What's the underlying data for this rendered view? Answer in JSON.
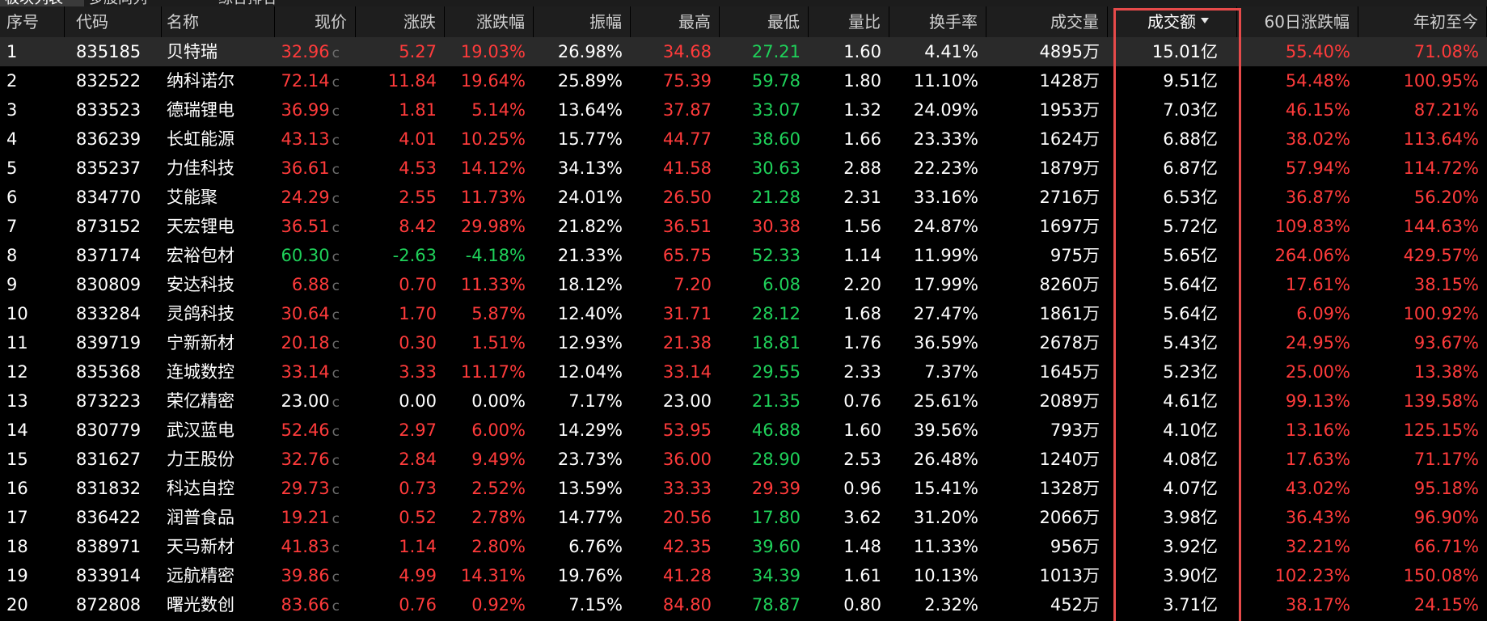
{
  "tabs": [
    {
      "label": "板块列表"
    },
    {
      "label": "多股同列"
    },
    {
      "label": "综合排名"
    }
  ],
  "columns": [
    {
      "key": "seq",
      "label": "序号"
    },
    {
      "key": "code",
      "label": "代码"
    },
    {
      "key": "name",
      "label": "名称"
    },
    {
      "key": "price",
      "label": "现价"
    },
    {
      "key": "change",
      "label": "涨跌"
    },
    {
      "key": "pct",
      "label": "涨跌幅"
    },
    {
      "key": "amp",
      "label": "振幅"
    },
    {
      "key": "high",
      "label": "最高"
    },
    {
      "key": "low",
      "label": "最低"
    },
    {
      "key": "vr",
      "label": "量比"
    },
    {
      "key": "turn",
      "label": "换手率"
    },
    {
      "key": "vol",
      "label": "成交量"
    },
    {
      "key": "amount",
      "label": "成交额"
    },
    {
      "key": "pct60",
      "label": "60日涨跌幅"
    },
    {
      "key": "ytd",
      "label": "年初至今"
    }
  ],
  "sort_column": "amount",
  "price_suffix": "c",
  "colors": {
    "up": "#ff3b3b",
    "down": "#1fd15a",
    "flat": "#ffffff",
    "highlight_border": "#e64a4a"
  },
  "rows": [
    {
      "seq": "1",
      "code": "835185",
      "name": "贝特瑞",
      "price": "32.96",
      "change": "5.27",
      "pct": "19.03%",
      "amp": "26.98%",
      "high": "34.68",
      "low": "27.21",
      "vr": "1.60",
      "turn": "4.41%",
      "vol": "4895万",
      "amount": "15.01亿",
      "pct60": "55.40%",
      "ytd": "71.08%",
      "price_c": "red",
      "high_c": "red",
      "low_c": "green",
      "pct60_c": "red",
      "ytd_c": "red"
    },
    {
      "seq": "2",
      "code": "832522",
      "name": "纳科诺尔",
      "price": "72.14",
      "change": "11.84",
      "pct": "19.64%",
      "amp": "25.89%",
      "high": "75.39",
      "low": "59.78",
      "vr": "1.80",
      "turn": "11.10%",
      "vol": "1428万",
      "amount": "9.51亿",
      "pct60": "54.48%",
      "ytd": "100.95%",
      "price_c": "red",
      "high_c": "red",
      "low_c": "green",
      "pct60_c": "red",
      "ytd_c": "red"
    },
    {
      "seq": "3",
      "code": "833523",
      "name": "德瑞锂电",
      "price": "36.99",
      "change": "1.81",
      "pct": "5.14%",
      "amp": "13.64%",
      "high": "37.87",
      "low": "33.07",
      "vr": "1.32",
      "turn": "24.09%",
      "vol": "1953万",
      "amount": "7.03亿",
      "pct60": "46.15%",
      "ytd": "87.21%",
      "price_c": "red",
      "high_c": "red",
      "low_c": "green",
      "pct60_c": "red",
      "ytd_c": "red"
    },
    {
      "seq": "4",
      "code": "836239",
      "name": "长虹能源",
      "price": "43.13",
      "change": "4.01",
      "pct": "10.25%",
      "amp": "15.77%",
      "high": "44.77",
      "low": "38.60",
      "vr": "1.66",
      "turn": "23.33%",
      "vol": "1624万",
      "amount": "6.88亿",
      "pct60": "38.02%",
      "ytd": "113.64%",
      "price_c": "red",
      "high_c": "red",
      "low_c": "green",
      "pct60_c": "red",
      "ytd_c": "red"
    },
    {
      "seq": "5",
      "code": "835237",
      "name": "力佳科技",
      "price": "36.61",
      "change": "4.53",
      "pct": "14.12%",
      "amp": "34.13%",
      "high": "41.58",
      "low": "30.63",
      "vr": "2.88",
      "turn": "22.23%",
      "vol": "1879万",
      "amount": "6.87亿",
      "pct60": "57.94%",
      "ytd": "114.72%",
      "price_c": "red",
      "high_c": "red",
      "low_c": "green",
      "pct60_c": "red",
      "ytd_c": "red"
    },
    {
      "seq": "6",
      "code": "834770",
      "name": "艾能聚",
      "price": "24.29",
      "change": "2.55",
      "pct": "11.73%",
      "amp": "24.01%",
      "high": "26.50",
      "low": "21.28",
      "vr": "2.31",
      "turn": "33.16%",
      "vol": "2716万",
      "amount": "6.53亿",
      "pct60": "36.87%",
      "ytd": "56.20%",
      "price_c": "red",
      "high_c": "red",
      "low_c": "green",
      "pct60_c": "red",
      "ytd_c": "red"
    },
    {
      "seq": "7",
      "code": "873152",
      "name": "天宏锂电",
      "price": "36.51",
      "change": "8.42",
      "pct": "29.98%",
      "amp": "21.82%",
      "high": "36.51",
      "low": "30.38",
      "vr": "1.56",
      "turn": "24.87%",
      "vol": "1697万",
      "amount": "5.72亿",
      "pct60": "109.83%",
      "ytd": "144.63%",
      "price_c": "red",
      "high_c": "red",
      "low_c": "red",
      "pct60_c": "red",
      "ytd_c": "red"
    },
    {
      "seq": "8",
      "code": "837174",
      "name": "宏裕包材",
      "price": "60.30",
      "change": "-2.63",
      "pct": "-4.18%",
      "amp": "21.33%",
      "high": "65.75",
      "low": "52.33",
      "vr": "1.14",
      "turn": "11.99%",
      "vol": "975万",
      "amount": "5.65亿",
      "pct60": "264.06%",
      "ytd": "429.57%",
      "price_c": "green",
      "high_c": "red",
      "low_c": "green",
      "pct60_c": "red",
      "ytd_c": "red"
    },
    {
      "seq": "9",
      "code": "830809",
      "name": "安达科技",
      "price": "6.88",
      "change": "0.70",
      "pct": "11.33%",
      "amp": "18.12%",
      "high": "7.20",
      "low": "6.08",
      "vr": "2.20",
      "turn": "17.99%",
      "vol": "8260万",
      "amount": "5.64亿",
      "pct60": "17.61%",
      "ytd": "38.15%",
      "price_c": "red",
      "high_c": "red",
      "low_c": "green",
      "pct60_c": "red",
      "ytd_c": "red"
    },
    {
      "seq": "10",
      "code": "833284",
      "name": "灵鸽科技",
      "price": "30.64",
      "change": "1.70",
      "pct": "5.87%",
      "amp": "12.40%",
      "high": "31.71",
      "low": "28.12",
      "vr": "1.68",
      "turn": "27.47%",
      "vol": "1861万",
      "amount": "5.64亿",
      "pct60": "6.09%",
      "ytd": "100.92%",
      "price_c": "red",
      "high_c": "red",
      "low_c": "green",
      "pct60_c": "red",
      "ytd_c": "red"
    },
    {
      "seq": "11",
      "code": "839719",
      "name": "宁新新材",
      "price": "20.18",
      "change": "0.30",
      "pct": "1.51%",
      "amp": "12.93%",
      "high": "21.38",
      "low": "18.81",
      "vr": "1.76",
      "turn": "36.59%",
      "vol": "2678万",
      "amount": "5.43亿",
      "pct60": "24.95%",
      "ytd": "93.67%",
      "price_c": "red",
      "high_c": "red",
      "low_c": "green",
      "pct60_c": "red",
      "ytd_c": "red"
    },
    {
      "seq": "12",
      "code": "835368",
      "name": "连城数控",
      "price": "33.14",
      "change": "3.33",
      "pct": "11.17%",
      "amp": "12.04%",
      "high": "33.14",
      "low": "29.55",
      "vr": "2.33",
      "turn": "7.37%",
      "vol": "1645万",
      "amount": "5.23亿",
      "pct60": "25.00%",
      "ytd": "13.38%",
      "price_c": "red",
      "high_c": "red",
      "low_c": "green",
      "pct60_c": "red",
      "ytd_c": "red"
    },
    {
      "seq": "13",
      "code": "873223",
      "name": "荣亿精密",
      "price": "23.00",
      "change": "0.00",
      "pct": "0.00%",
      "amp": "7.17%",
      "high": "23.00",
      "low": "21.35",
      "vr": "0.76",
      "turn": "25.61%",
      "vol": "2089万",
      "amount": "4.61亿",
      "pct60": "99.13%",
      "ytd": "139.58%",
      "price_c": "white",
      "high_c": "white",
      "low_c": "green",
      "pct60_c": "red",
      "ytd_c": "red"
    },
    {
      "seq": "14",
      "code": "830779",
      "name": "武汉蓝电",
      "price": "52.46",
      "change": "2.97",
      "pct": "6.00%",
      "amp": "14.29%",
      "high": "53.95",
      "low": "46.88",
      "vr": "1.60",
      "turn": "39.56%",
      "vol": "793万",
      "amount": "4.10亿",
      "pct60": "13.16%",
      "ytd": "125.15%",
      "price_c": "red",
      "high_c": "red",
      "low_c": "green",
      "pct60_c": "red",
      "ytd_c": "red"
    },
    {
      "seq": "15",
      "code": "831627",
      "name": "力王股份",
      "price": "32.76",
      "change": "2.84",
      "pct": "9.49%",
      "amp": "23.73%",
      "high": "36.00",
      "low": "28.90",
      "vr": "2.53",
      "turn": "26.48%",
      "vol": "1240万",
      "amount": "4.08亿",
      "pct60": "17.63%",
      "ytd": "71.17%",
      "price_c": "red",
      "high_c": "red",
      "low_c": "green",
      "pct60_c": "red",
      "ytd_c": "red"
    },
    {
      "seq": "16",
      "code": "831832",
      "name": "科达自控",
      "price": "29.73",
      "change": "0.73",
      "pct": "2.52%",
      "amp": "13.59%",
      "high": "33.33",
      "low": "29.39",
      "vr": "0.96",
      "turn": "15.41%",
      "vol": "1328万",
      "amount": "4.07亿",
      "pct60": "43.02%",
      "ytd": "95.18%",
      "price_c": "red",
      "high_c": "red",
      "low_c": "red",
      "pct60_c": "red",
      "ytd_c": "red"
    },
    {
      "seq": "17",
      "code": "836422",
      "name": "润普食品",
      "price": "19.21",
      "change": "0.52",
      "pct": "2.78%",
      "amp": "14.77%",
      "high": "20.56",
      "low": "17.80",
      "vr": "3.62",
      "turn": "31.20%",
      "vol": "2066万",
      "amount": "3.98亿",
      "pct60": "36.43%",
      "ytd": "96.90%",
      "price_c": "red",
      "high_c": "red",
      "low_c": "green",
      "pct60_c": "red",
      "ytd_c": "red"
    },
    {
      "seq": "18",
      "code": "838971",
      "name": "天马新材",
      "price": "41.83",
      "change": "1.14",
      "pct": "2.80%",
      "amp": "6.76%",
      "high": "42.35",
      "low": "39.60",
      "vr": "1.48",
      "turn": "11.33%",
      "vol": "956万",
      "amount": "3.92亿",
      "pct60": "32.21%",
      "ytd": "66.71%",
      "price_c": "red",
      "high_c": "red",
      "low_c": "green",
      "pct60_c": "red",
      "ytd_c": "red"
    },
    {
      "seq": "19",
      "code": "833914",
      "name": "远航精密",
      "price": "39.86",
      "change": "4.99",
      "pct": "14.31%",
      "amp": "19.76%",
      "high": "41.28",
      "low": "34.39",
      "vr": "1.61",
      "turn": "10.13%",
      "vol": "1013万",
      "amount": "3.90亿",
      "pct60": "102.23%",
      "ytd": "150.08%",
      "price_c": "red",
      "high_c": "red",
      "low_c": "green",
      "pct60_c": "red",
      "ytd_c": "red"
    },
    {
      "seq": "20",
      "code": "872808",
      "name": "曙光数创",
      "price": "83.66",
      "change": "0.76",
      "pct": "0.92%",
      "amp": "7.15%",
      "high": "84.80",
      "low": "78.87",
      "vr": "0.80",
      "turn": "2.32%",
      "vol": "452万",
      "amount": "3.71亿",
      "pct60": "38.17%",
      "ytd": "24.15%",
      "price_c": "red",
      "high_c": "red",
      "low_c": "green",
      "pct60_c": "red",
      "ytd_c": "red"
    }
  ]
}
